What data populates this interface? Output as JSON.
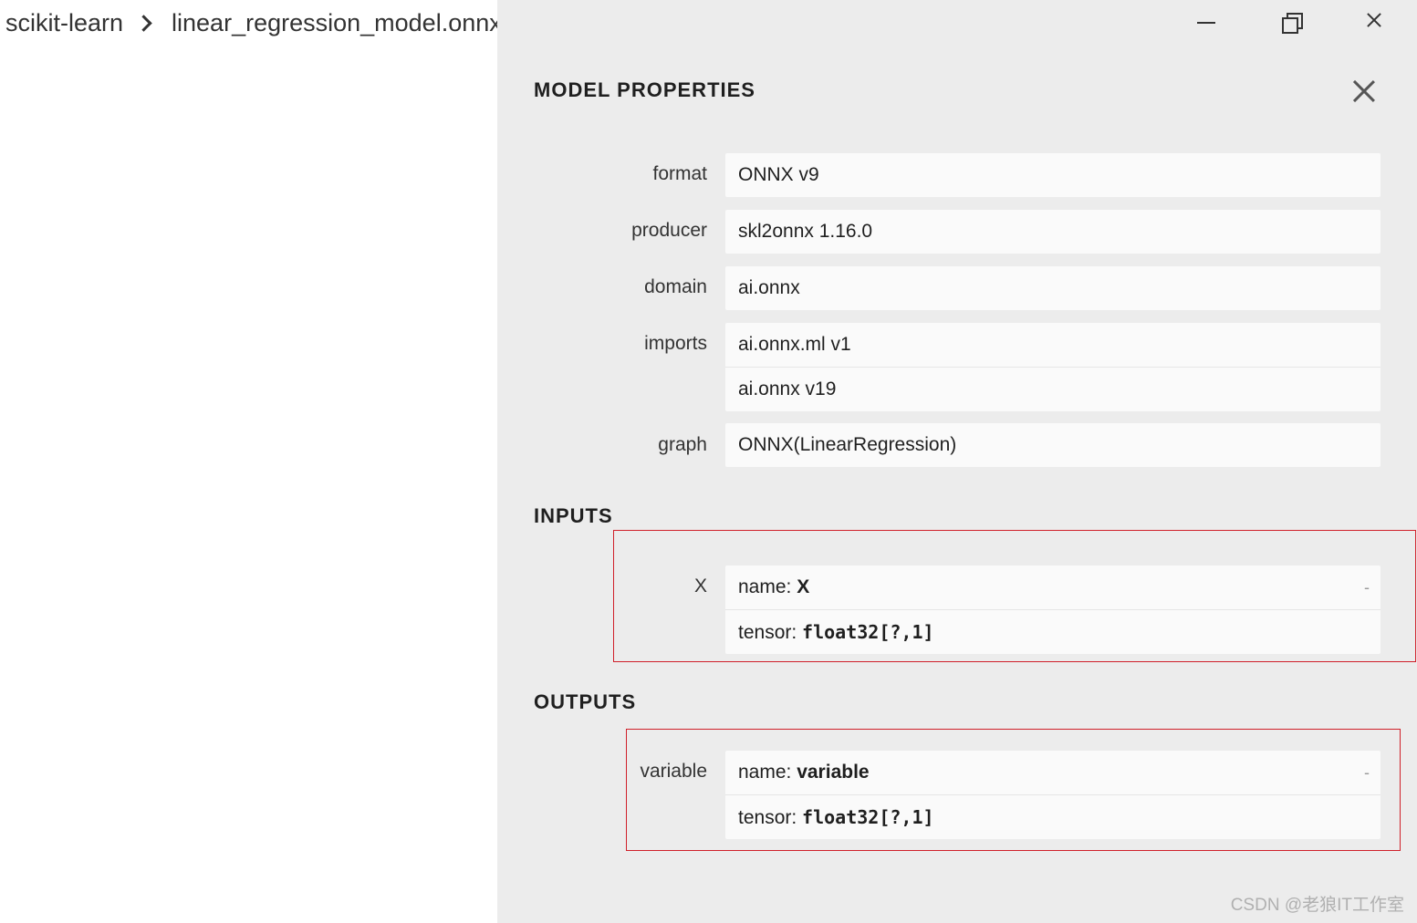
{
  "breadcrumb": {
    "items": [
      "scikit-learn",
      "linear_regression_model.onnx"
    ]
  },
  "panel": {
    "title": "MODEL PROPERTIES",
    "properties": [
      {
        "label": "format",
        "values": [
          "ONNX v9"
        ]
      },
      {
        "label": "producer",
        "values": [
          "skl2onnx 1.16.0"
        ]
      },
      {
        "label": "domain",
        "values": [
          "ai.onnx"
        ]
      },
      {
        "label": "imports",
        "values": [
          "ai.onnx.ml v1",
          "ai.onnx v19"
        ]
      },
      {
        "label": "graph",
        "values": [
          "ONNX(LinearRegression)"
        ]
      }
    ],
    "inputs": {
      "title": "INPUTS",
      "items": [
        {
          "label": "X",
          "name_prefix": "name: ",
          "name": "X",
          "tensor_prefix": "tensor: ",
          "tensor": "float32[?,1]",
          "expand": "-"
        }
      ]
    },
    "outputs": {
      "title": "OUTPUTS",
      "items": [
        {
          "label": "variable",
          "name_prefix": "name: ",
          "name": "variable",
          "tensor_prefix": "tensor: ",
          "tensor": "float32[?,1]",
          "expand": "-"
        }
      ]
    }
  },
  "watermark": "CSDN @老狼IT工作室",
  "colors": {
    "panel_bg": "#ececec",
    "box_bg": "#fafafa",
    "highlight": "#d0202a"
  }
}
